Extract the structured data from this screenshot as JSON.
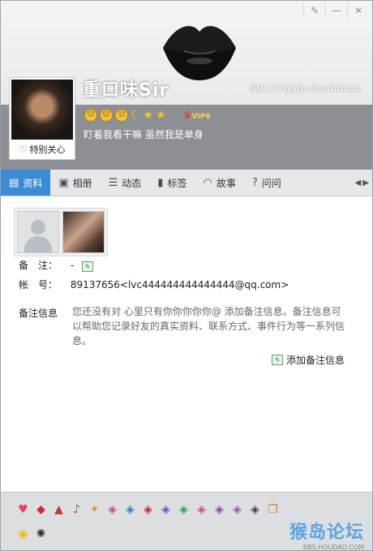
{
  "window": {
    "controls": [
      "✎",
      "—",
      "✕"
    ]
  },
  "profile": {
    "nickname": "重口味Sir",
    "account_short": "89137656<lvc44444",
    "signature": "盯着我看干嘛 虽然我是单身",
    "special_care": "特别关心",
    "vip_label": "VIP6"
  },
  "tabs": [
    {
      "label": "资料",
      "icon": "profile-card-icon",
      "active": true
    },
    {
      "label": "相册",
      "icon": "photo-album-icon",
      "active": false
    },
    {
      "label": "动态",
      "icon": "feed-list-icon",
      "active": false
    },
    {
      "label": "标签",
      "icon": "tag-icon",
      "active": false
    },
    {
      "label": "故事",
      "icon": "story-signal-icon",
      "active": false
    },
    {
      "label": "问问",
      "icon": "question-icon",
      "active": false
    }
  ],
  "info": {
    "remark_label": "备　注：",
    "remark_value": "-",
    "account_label": "帐　号：",
    "account_value": "89137656<lvc444444444444444@qq.com>",
    "memo_label": "备注信息",
    "memo_text": "您还没有对 心里只有你你你你你@ 添加备注信息。备注信息可以帮助您记录好友的真实资料、联系方式、事件行为等一系列信息。",
    "add_memo": "添加备注信息"
  },
  "watermark": {
    "line1": "猴岛论坛",
    "line2": "BBS.HOUDAO.COM"
  },
  "colors": {
    "tab_active": "#3c8bd5",
    "header_band": "#8c8f94",
    "footer": "#dcdee1"
  }
}
